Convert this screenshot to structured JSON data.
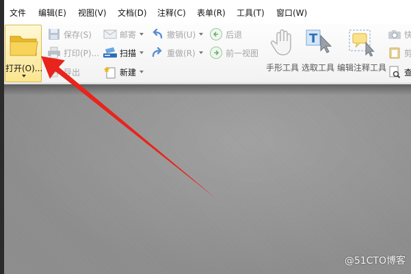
{
  "menu": {
    "items": [
      "文件",
      "编辑(E)",
      "视图(V)",
      "文档(D)",
      "注释(C)",
      "表单(R)",
      "工具(T)",
      "窗口(W)"
    ]
  },
  "toolbar": {
    "open_label": "打开(O)...",
    "save_label": "保存(S)",
    "print_label": "打印(P)...",
    "export_label": "导出",
    "email_label": "邮寄",
    "scan_label": "扫描",
    "new_label": "新建",
    "undo_label": "撤销(U)",
    "redo_label": "重做(R)",
    "back_label": "后退",
    "prev_view_label": "前一视图",
    "hand_tool_label": "手形工具",
    "select_text_label": "选取工具",
    "edit_annot_label": "编辑注释工具",
    "partial_label_1": "快",
    "partial_label_2": "剪",
    "partial_label_3": "查"
  },
  "watermark": "@51CTO博客",
  "colors": {
    "arrow": "#e8241c",
    "open_button_bg": "#fbe58f",
    "workspace": "#8e8e8e"
  }
}
